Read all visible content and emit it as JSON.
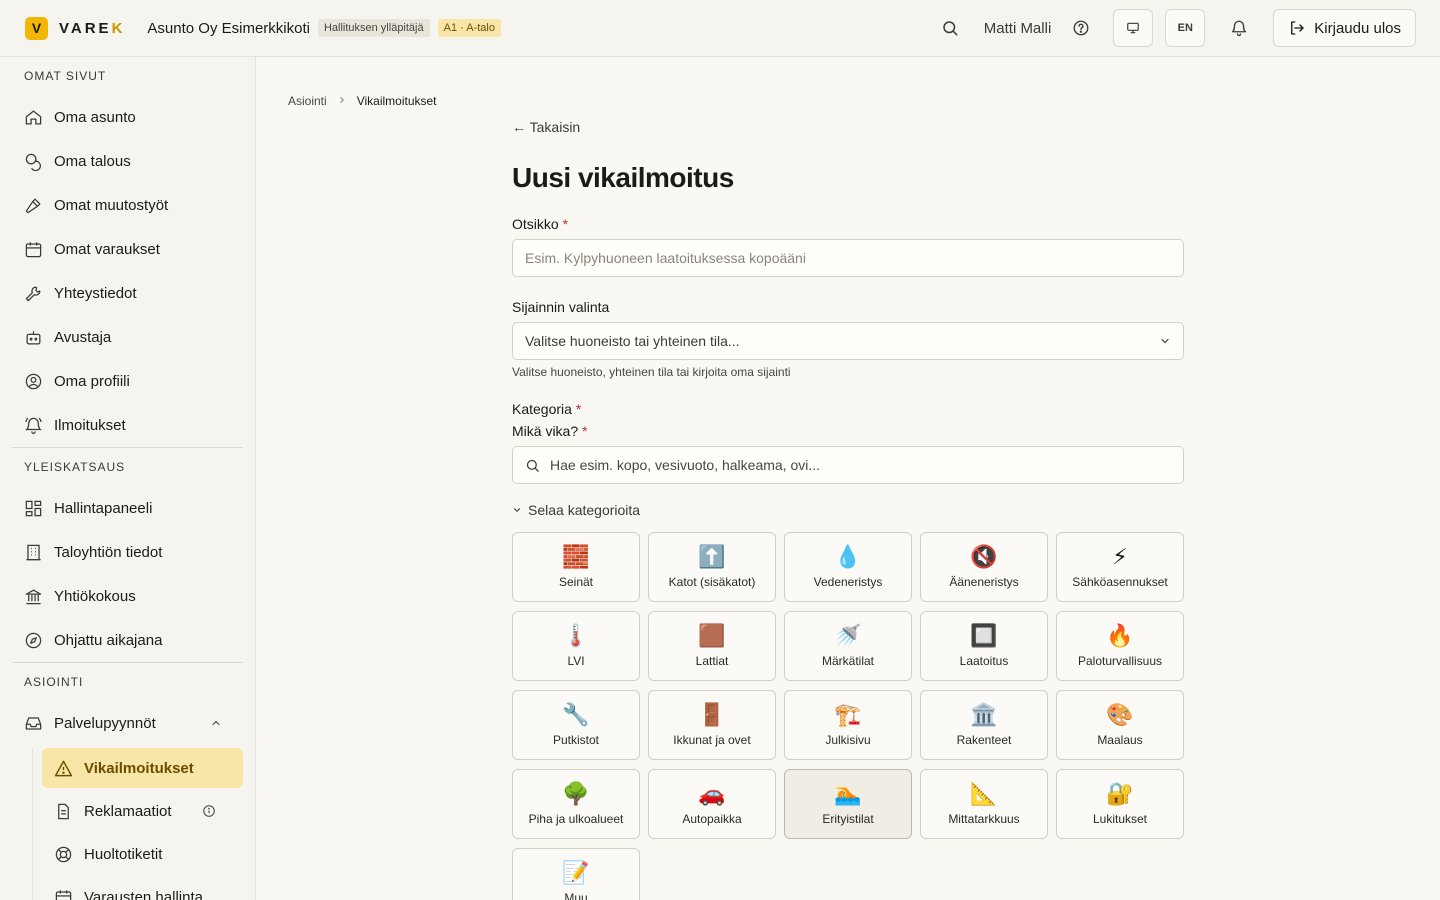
{
  "header": {
    "logo_letter": "V",
    "logo_text_main": "VARE",
    "logo_text_last": "K",
    "org_name": "Asunto Oy Esimerkkikoti",
    "role_badge": "Hallituksen ylläpitäjä",
    "apartment_badge": "A1 · A-talo",
    "user_name": "Matti Malli",
    "language": "EN",
    "logout_label": "Kirjaudu ulos"
  },
  "sidebar": {
    "sections": [
      {
        "title": "OMAT SIVUT",
        "items": [
          {
            "label": "Oma asunto",
            "icon": "home-icon"
          },
          {
            "label": "Oma talous",
            "icon": "coins-icon"
          },
          {
            "label": "Omat muutostyöt",
            "icon": "hammer-icon"
          },
          {
            "label": "Omat varaukset",
            "icon": "calendar-icon"
          },
          {
            "label": "Yhteystiedot",
            "icon": "wrench-icon"
          },
          {
            "label": "Avustaja",
            "icon": "bot-icon"
          },
          {
            "label": "Oma profiili",
            "icon": "user-circle-icon"
          },
          {
            "label": "Ilmoitukset",
            "icon": "bell-ring-icon"
          }
        ]
      },
      {
        "title": "YLEISKATSAUS",
        "items": [
          {
            "label": "Hallintapaneeli",
            "icon": "dashboard-icon"
          },
          {
            "label": "Taloyhtiön tiedot",
            "icon": "building-icon"
          },
          {
            "label": "Yhtiökokous",
            "icon": "landmark-icon"
          },
          {
            "label": "Ohjattu aikajana",
            "icon": "compass-icon"
          }
        ]
      },
      {
        "title": "ASIOINTI",
        "parent": {
          "label": "Palvelupyynnöt",
          "icon": "inbox-icon"
        },
        "sub_items": [
          {
            "label": "Vikailmoitukset",
            "icon": "warning-icon",
            "active": true
          },
          {
            "label": "Reklamaatiot",
            "icon": "document-icon"
          },
          {
            "label": "Huoltotiketit",
            "icon": "lifebuoy-icon"
          },
          {
            "label": "Varausten hallinta",
            "icon": "calendar-icon"
          }
        ]
      }
    ]
  },
  "breadcrumb": {
    "parent": "Asiointi",
    "current": "Vikailmoitukset"
  },
  "form": {
    "back_label": "← Takaisin",
    "title": "Uusi vikailmoitus",
    "title_field": {
      "label": "Otsikko",
      "required": "*",
      "value": "",
      "placeholder": "Esim. Kylpyhuoneen laatoituksessa kopoääni"
    },
    "location_field": {
      "label": "Sijainnin valinta",
      "selected": "Valitse huoneisto tai yhteinen tila...",
      "hint": "Valitse huoneisto, yhteinen tila tai kirjoita oma sijainti"
    },
    "category_label": "Kategoria",
    "category_required": "*",
    "fault_label": "Mikä vika?",
    "fault_required": "*",
    "fault_search_placeholder": "Hae esim. kopo, vesivuoto, halkeama, ovi...",
    "browse_label": "Selaa kategorioita",
    "categories": [
      {
        "emoji": "🧱",
        "name": "Seinät"
      },
      {
        "emoji": "⬆️",
        "name": "Katot (sisäkatot)"
      },
      {
        "emoji": "💧",
        "name": "Vedeneristys"
      },
      {
        "emoji": "🔇",
        "name": "Ääneneristys"
      },
      {
        "emoji": "⚡",
        "name": "Sähköasennukset"
      },
      {
        "emoji": "🌡️",
        "name": "LVI"
      },
      {
        "emoji": "🟫",
        "name": "Lattiat"
      },
      {
        "emoji": "🚿",
        "name": "Märkätilat"
      },
      {
        "emoji": "🔲",
        "name": "Laatoitus"
      },
      {
        "emoji": "🔥",
        "name": "Paloturvallisuus"
      },
      {
        "emoji": "🔧",
        "name": "Putkistot"
      },
      {
        "emoji": "🚪",
        "name": "Ikkunat ja ovet"
      },
      {
        "emoji": "🏗️",
        "name": "Julkisivu"
      },
      {
        "emoji": "🏛️",
        "name": "Rakenteet"
      },
      {
        "emoji": "🎨",
        "name": "Maalaus"
      },
      {
        "emoji": "🌳",
        "name": "Piha ja ulkoalueet"
      },
      {
        "emoji": "🚗",
        "name": "Autopaikka"
      },
      {
        "emoji": "🏊",
        "name": "Erityistilat",
        "selected": true
      },
      {
        "emoji": "📐",
        "name": "Mittatarkkuus"
      },
      {
        "emoji": "🔐",
        "name": "Lukitukset"
      },
      {
        "emoji": "📝",
        "name": "Muu"
      }
    ]
  }
}
